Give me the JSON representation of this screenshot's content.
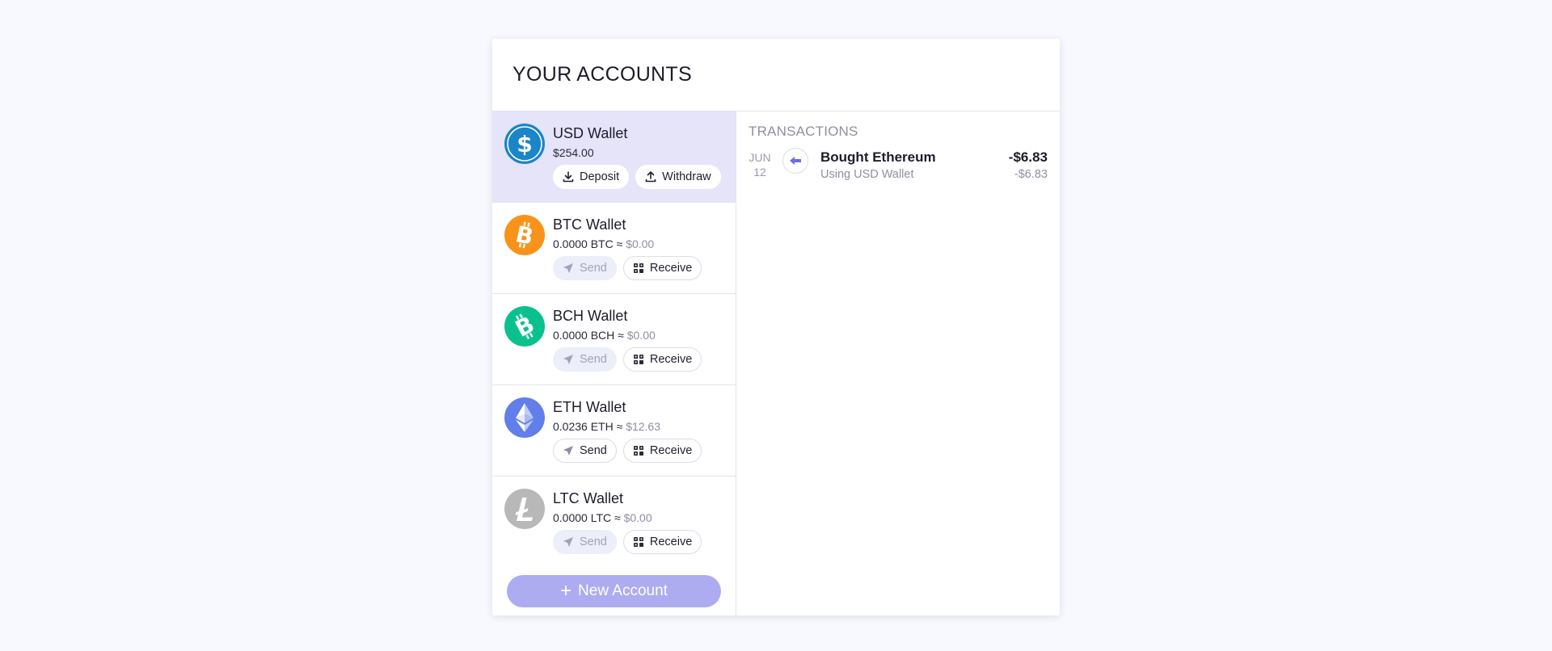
{
  "header": {
    "title": "YOUR ACCOUNTS"
  },
  "accounts": [
    {
      "name": "USD Wallet",
      "balance": "$254.00",
      "fiat": "",
      "icon": "usd-coin-icon",
      "color": "#1a85c8",
      "active": true,
      "actions": [
        {
          "label": "Deposit",
          "icon": "download-icon",
          "enabled": true
        },
        {
          "label": "Withdraw",
          "icon": "upload-icon",
          "enabled": true
        }
      ]
    },
    {
      "name": "BTC Wallet",
      "balance": "0.0000 BTC ≈ ",
      "fiat": "$0.00",
      "icon": "bitcoin-icon",
      "color": "#f7931a",
      "active": false,
      "actions": [
        {
          "label": "Send",
          "icon": "send-icon",
          "enabled": false
        },
        {
          "label": "Receive",
          "icon": "qr-code-icon",
          "enabled": true
        }
      ]
    },
    {
      "name": "BCH Wallet",
      "balance": "0.0000 BCH ≈ ",
      "fiat": "$0.00",
      "icon": "bitcoin-cash-icon",
      "color": "#0ac18e",
      "active": false,
      "actions": [
        {
          "label": "Send",
          "icon": "send-icon",
          "enabled": false
        },
        {
          "label": "Receive",
          "icon": "qr-code-icon",
          "enabled": true
        }
      ]
    },
    {
      "name": "ETH Wallet",
      "balance": "0.0236 ETH ≈ ",
      "fiat": "$12.63",
      "icon": "ethereum-icon",
      "color": "#627eea",
      "active": false,
      "actions": [
        {
          "label": "Send",
          "icon": "send-icon",
          "enabled": true
        },
        {
          "label": "Receive",
          "icon": "qr-code-icon",
          "enabled": true
        }
      ]
    },
    {
      "name": "LTC Wallet",
      "balance": "0.0000 LTC ≈ ",
      "fiat": "$0.00",
      "icon": "litecoin-icon",
      "color": "#b8b8b8",
      "active": false,
      "actions": [
        {
          "label": "Send",
          "icon": "send-icon",
          "enabled": false
        },
        {
          "label": "Receive",
          "icon": "qr-code-icon",
          "enabled": true
        }
      ]
    }
  ],
  "new_account": {
    "label": "New Account",
    "color": "#aeacf0"
  },
  "transactions": {
    "title": "TRANSACTIONS",
    "items": [
      {
        "month": "JUN",
        "day": "12",
        "icon": "arrow-left-icon",
        "name": "Bought Ethereum",
        "sub": "Using USD Wallet",
        "amount": "-$6.83",
        "amount_secondary": "-$6.83"
      }
    ]
  },
  "colors": {
    "accent": "#6e6ce0",
    "active_row": "#e5e4f9",
    "background": "#f8f9fe"
  }
}
